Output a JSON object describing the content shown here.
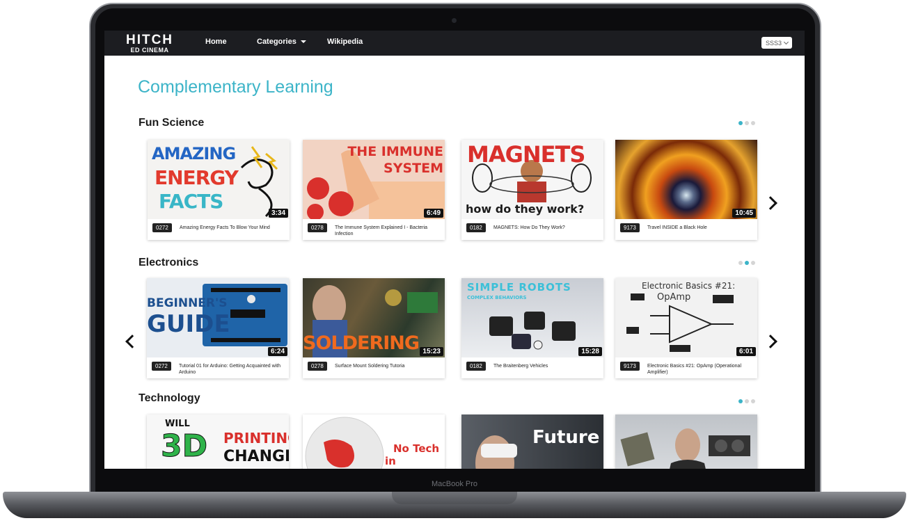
{
  "device": {
    "label": "MacBook Pro"
  },
  "navbar": {
    "logo_main": "HITCH",
    "logo_sub": "ED CINEMA",
    "links": {
      "home": "Home",
      "categories": "Categories",
      "wikipedia": "Wikipedia"
    },
    "grade_select": {
      "value": "SSS3"
    }
  },
  "page": {
    "title": "Complementary Learning"
  },
  "sections": [
    {
      "title": "Fun Science",
      "dots": [
        true,
        false,
        false
      ],
      "cards": [
        {
          "code": "0272",
          "title": "Amazing Energy Facts To Blow Your Mind",
          "duration": "3:34",
          "thumb_text": [
            "AMAZING",
            "ENERGY",
            "FACTS"
          ]
        },
        {
          "code": "0278",
          "title": "The Immune System Explained I - Bacteria Infection",
          "duration": "6:49",
          "thumb_text": [
            "THE IMMUNE",
            "SYSTEM"
          ]
        },
        {
          "code": "0182",
          "title": "MAGNETS: How Do They Work?",
          "duration": "",
          "thumb_text": [
            "MAGNETS",
            "how do they work?"
          ]
        },
        {
          "code": "9173",
          "title": "Travel INSIDE a Black Hole",
          "duration": "10:45",
          "thumb_text": []
        }
      ]
    },
    {
      "title": "Electronics",
      "dots": [
        false,
        true,
        false
      ],
      "cards": [
        {
          "code": "0272",
          "title": "Tutorial 01 for Arduino: Getting Acquainted with Arduino",
          "duration": "6:24",
          "thumb_text": [
            "BEGINNER'S",
            "GUIDE"
          ]
        },
        {
          "code": "0278",
          "title": "Surface Mount Soldering Tutoria",
          "duration": "15:23",
          "thumb_text": [
            "SOLDERING"
          ]
        },
        {
          "code": "0182",
          "title": "The Braitenberg Vehicles",
          "duration": "15:28",
          "thumb_text": [
            "SIMPLE ROBOTS",
            "COMPLEX BEHAVIORS"
          ]
        },
        {
          "code": "9173",
          "title": "Electronic Basics #21: OpAmp (Operational Amplifier)",
          "duration": "6:01",
          "thumb_text": [
            "Electronic Basics #21:",
            "OpAmp"
          ]
        }
      ]
    },
    {
      "title": "Technology",
      "dots": [
        true,
        false,
        false
      ],
      "cards": [
        {
          "thumb_text": [
            "WILL",
            "3D",
            "PRINTING",
            "CHANGE"
          ]
        },
        {
          "thumb_text": [
            "No Tech",
            "in Europe?"
          ]
        },
        {
          "thumb_text": [
            "Future"
          ]
        },
        {
          "thumb_text": []
        }
      ]
    }
  ],
  "colors": {
    "accent": "#3cb4c8",
    "navbar": "#1c1d21",
    "badge": "#222222"
  },
  "icons": [
    "chevron-right-icon",
    "chevron-left-icon",
    "caret-down-icon"
  ]
}
